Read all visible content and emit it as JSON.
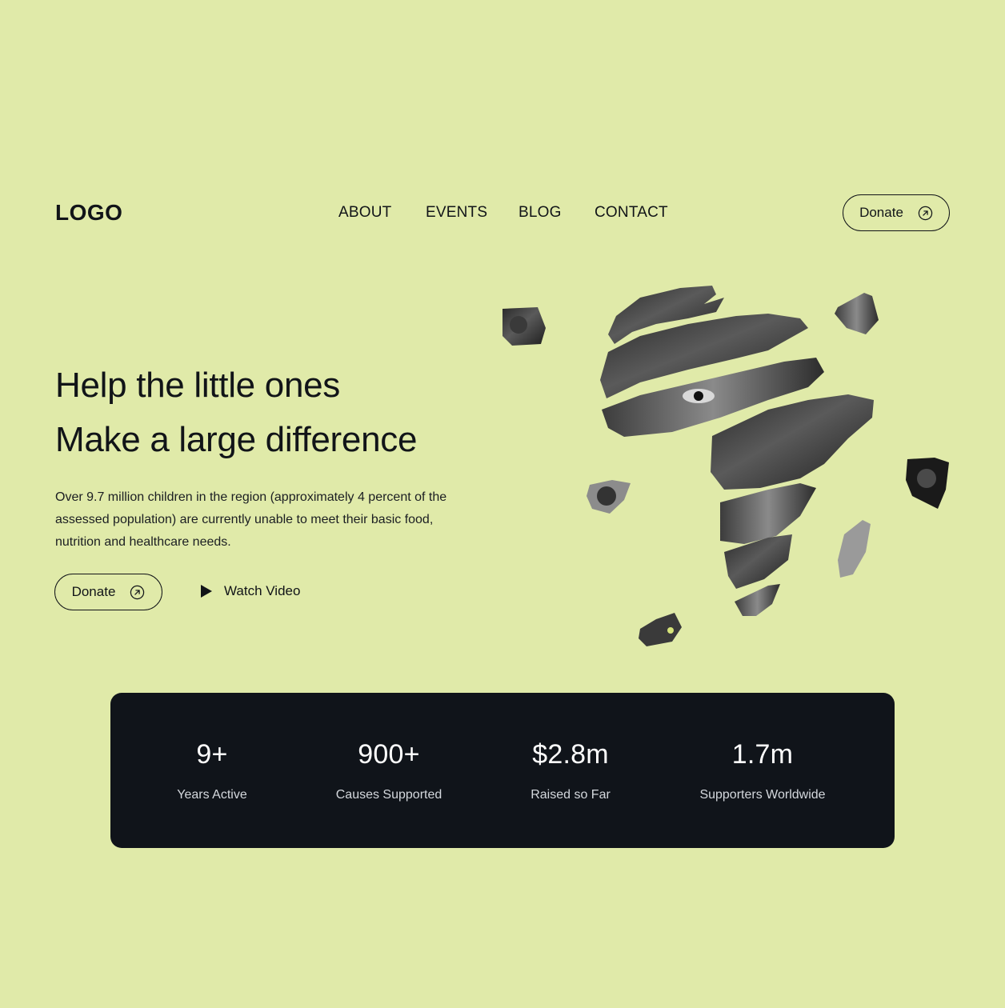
{
  "header": {
    "logo": "LOGO",
    "nav": [
      "ABOUT",
      "EVENTS",
      "BLOG",
      "CONTACT"
    ],
    "donate_label": "Donate"
  },
  "hero": {
    "title_line1": "Help the little ones",
    "title_line2": "Make a large difference",
    "description": "Over 9.7 million children in the region (approximately 4 percent of the assessed population) are currently unable to meet their basic food, nutrition and healthcare needs.",
    "donate_label": "Donate",
    "watch_label": "Watch Video"
  },
  "stats": [
    {
      "value": "9+",
      "label": "Years Active"
    },
    {
      "value": "900+",
      "label": "Causes Supported"
    },
    {
      "value": "$2.8m",
      "label": "Raised so Far"
    },
    {
      "value": "1.7m",
      "label": "Supporters Worldwide"
    }
  ],
  "icons": {
    "arrow": "arrow-up-right-circle-icon",
    "play": "play-icon"
  },
  "colors": {
    "background": "#e0eaa9",
    "text": "#111418",
    "stats_panel": "#10141a"
  }
}
